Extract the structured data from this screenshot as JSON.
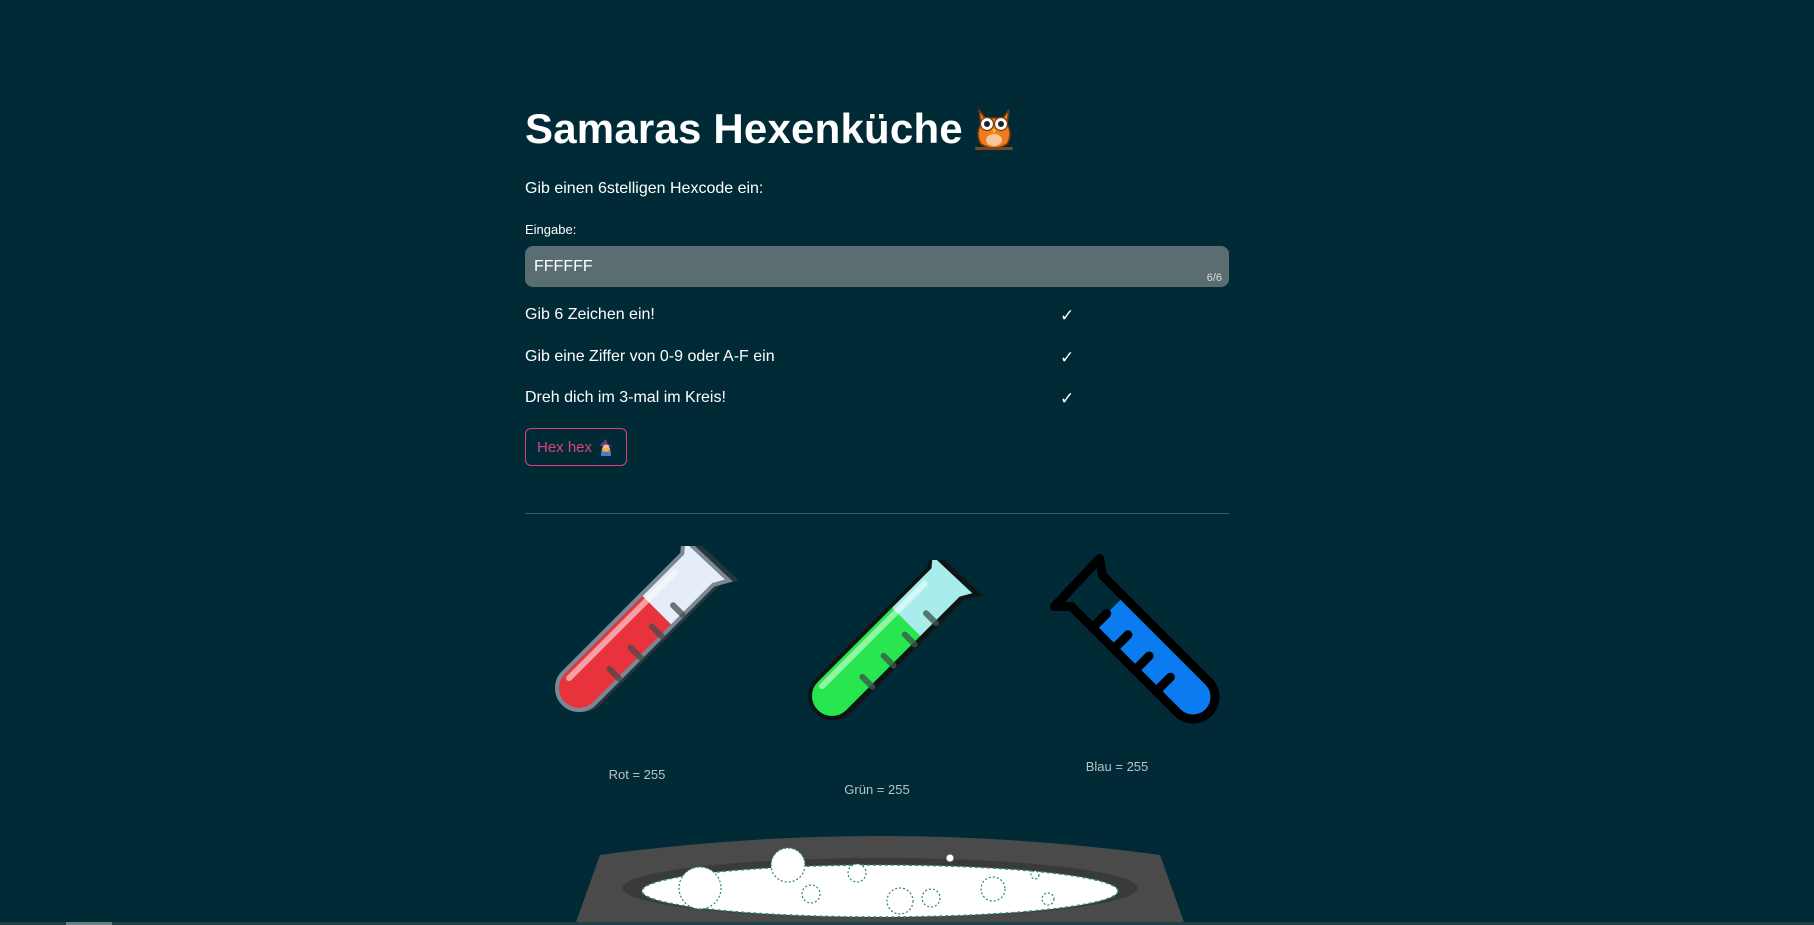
{
  "header": {
    "title": "Samaras Hexenküche",
    "title_icon": "owl-icon"
  },
  "form": {
    "instruction": "Gib einen 6stelligen Hexcode ein:",
    "input_label": "Eingabe:",
    "input_value": "FFFFFF",
    "char_counter": "6/6"
  },
  "requirements": [
    {
      "text": "Gib 6 Zeichen ein!",
      "check": "✓"
    },
    {
      "text": "Gib eine Ziffer von 0-9 oder A-F ein",
      "check": "✓"
    },
    {
      "text": "Dreh dich im 3-mal im Kreis!",
      "check": "✓"
    }
  ],
  "button": {
    "label": "Hex hex",
    "icon": "witch-icon",
    "color": "#e0407a"
  },
  "tubes": {
    "red": {
      "label": "Rot = 255",
      "value": 255,
      "color": "#e8323c"
    },
    "green": {
      "label": "Grün = 255",
      "value": 255,
      "color": "#27e650"
    },
    "blue": {
      "label": "Blau = 255",
      "value": 255,
      "color": "#0a7cf0"
    }
  },
  "cauldron": {
    "icon": "cauldron-icon",
    "liquid_color": "#ffffff"
  },
  "colors": {
    "background": "#002b36",
    "input_background": "#5a6e72",
    "accent": "#e0407a"
  }
}
